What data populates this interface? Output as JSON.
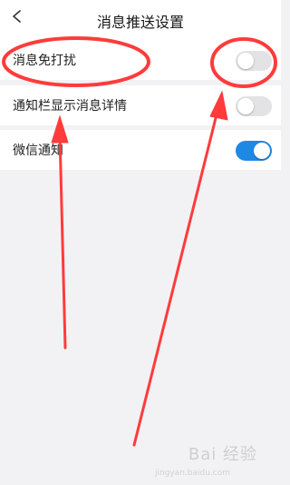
{
  "header": {
    "title": "消息推送设置",
    "back_icon": "chevron-left-icon"
  },
  "settings": [
    {
      "label": "消息免打扰",
      "state": "off"
    },
    {
      "label": "通知栏显示消息详情",
      "state": "off"
    },
    {
      "label": "微信通知",
      "state": "on"
    }
  ],
  "colors": {
    "toggle_on": "#1e88e5",
    "toggle_off": "#e3e3e6",
    "annotation": "#ff3b3b",
    "background": "#f2f2f4"
  },
  "watermark": {
    "text": "Bai 经验",
    "sub": "jingyan.baidu.com"
  }
}
